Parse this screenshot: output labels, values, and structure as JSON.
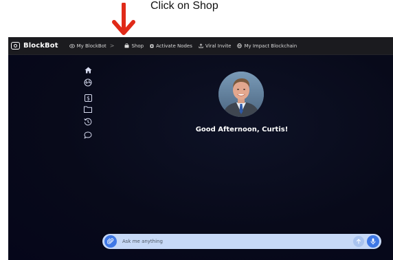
{
  "annotation": {
    "text": "Click on Shop",
    "arrow_color": "#e02a18"
  },
  "brand": {
    "name": "BlockBot",
    "logo_icon": "eye-box-icon"
  },
  "navbar": {
    "items": [
      {
        "label": "My BlockBot",
        "icon": "eye-icon"
      },
      {
        "label": "Shop",
        "icon": "shopping-bag-icon"
      },
      {
        "label": "Activate Nodes",
        "icon": "node-icon"
      },
      {
        "label": "Viral Invite",
        "icon": "upload-icon"
      },
      {
        "label": "My Impact Blockchain",
        "icon": "globe-icon"
      }
    ],
    "separator": ">"
  },
  "sidebar": {
    "icons": [
      "home-icon",
      "globe-icon",
      "dollar-box-icon",
      "folder-icon",
      "history-icon",
      "chat-bubble-icon"
    ]
  },
  "main": {
    "greeting": "Good Afternoon, Curtis!"
  },
  "chat": {
    "placeholder": "Ask me anything"
  },
  "colors": {
    "navbar_bg": "#1b1b1f",
    "app_bg": "#080a1a",
    "chat_bar": "#c7d9f7",
    "accent_blue": "#3f78e6"
  }
}
